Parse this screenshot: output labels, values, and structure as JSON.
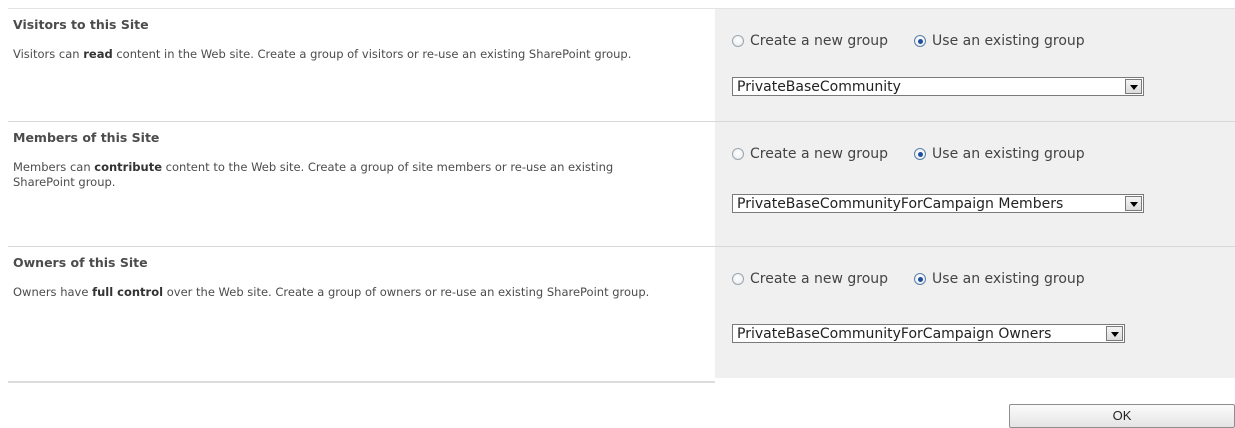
{
  "sections": [
    {
      "title": "Visitors to this Site",
      "text_pre": "Visitors can ",
      "text_bold": "read",
      "text_post": " content in the Web site. Create a group of visitors or re-use an existing SharePoint group.",
      "radio_new_label": "Create a new group",
      "radio_existing_label": "Use an existing group",
      "selected": "existing",
      "select_value": "PrivateBaseCommunity"
    },
    {
      "title": "Members of this Site",
      "text_pre": "Members can ",
      "text_bold": "contribute",
      "text_post": " content to the Web site. Create a group of site members or re-use an existing SharePoint group.",
      "radio_new_label": "Create a new group",
      "radio_existing_label": "Use an existing group",
      "selected": "existing",
      "select_value": "PrivateBaseCommunityForCampaign Members"
    },
    {
      "title": "Owners of this Site",
      "text_pre": "Owners have ",
      "text_bold": "full control",
      "text_post": " over the Web site. Create a group of owners or re-use an existing SharePoint group.",
      "radio_new_label": "Create a new group",
      "radio_existing_label": "Use an existing group",
      "selected": "existing",
      "select_value": "PrivateBaseCommunityForCampaign Owners"
    }
  ],
  "ok_label": "OK"
}
